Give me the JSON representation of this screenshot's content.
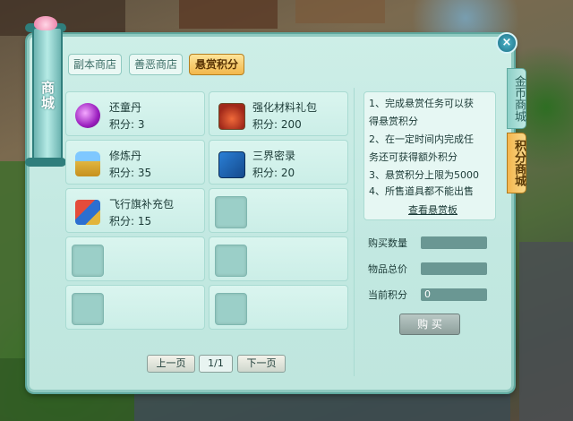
{
  "shop": {
    "side_title": "商城",
    "side_tabs": [
      {
        "label": "金币商城",
        "active": false
      },
      {
        "label": "积分商城",
        "active": true
      }
    ],
    "top_tabs": [
      {
        "label": "副本商店",
        "active": false
      },
      {
        "label": "善恶商店",
        "active": false
      },
      {
        "label": "悬赏积分",
        "active": true
      }
    ],
    "close_label": "×",
    "items": [
      {
        "name": "还童丹",
        "price_label": "积分:",
        "price": "3",
        "icon": "purple-orb-icon"
      },
      {
        "name": "强化材料礼包",
        "price_label": "积分:",
        "price": "200",
        "icon": "red-gift-bag-icon"
      },
      {
        "name": "修炼丹",
        "price_label": "积分:",
        "price": "35",
        "icon": "elixir-bottle-icon"
      },
      {
        "name": "三界密录",
        "price_label": "积分:",
        "price": "20",
        "icon": "blue-book-icon"
      },
      {
        "name": "飞行旗补充包",
        "price_label": "积分:",
        "price": "15",
        "icon": "flag-pack-icon"
      }
    ],
    "rules": [
      "1、完成悬赏任务可以获",
      "得悬赏积分",
      "2、在一定时间内完成任",
      "务还可获得额外积分",
      "3、悬赏积分上限为5000",
      "4、所售道具都不能出售"
    ],
    "view_bounty_link": "查看悬赏板",
    "form": {
      "quantity_label": "购买数量",
      "quantity_value": "",
      "total_label": "物品总价",
      "total_value": "",
      "current_label": "当前积分",
      "current_value": "0"
    },
    "buy_label": "购 买",
    "pagination": {
      "prev": "上一页",
      "indicator": "1/1",
      "next": "下一页"
    }
  },
  "colors": {
    "panel": "#c2e8e1",
    "active_tab": "#f2b74a",
    "accent": "#2f7e7c"
  }
}
